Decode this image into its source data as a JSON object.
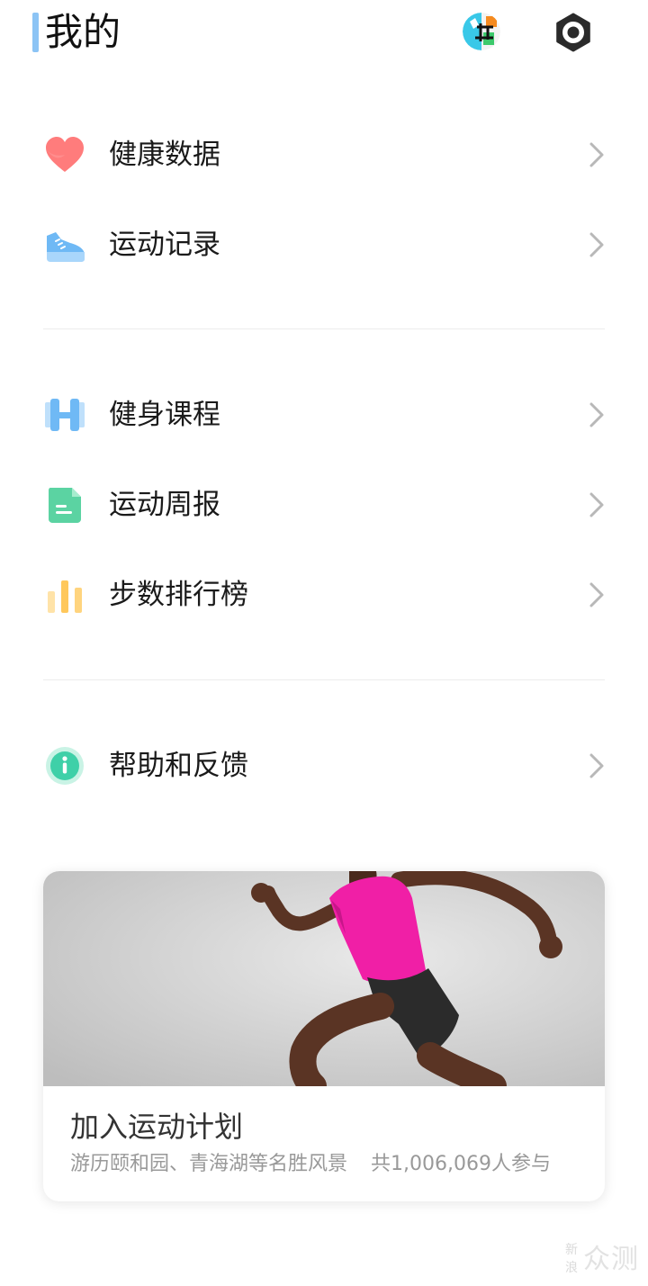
{
  "header": {
    "title": "我的"
  },
  "icons": {
    "avatar": "avatar-image",
    "settings": "settings-gear-icon",
    "heart": "heart-icon",
    "shoe": "running-shoe-icon",
    "course": "dumbbell-h-icon",
    "report": "document-icon",
    "ranking": "bar-chart-icon",
    "help": "info-icon",
    "chevron": "chevron-right-icon"
  },
  "colors": {
    "accent_bar": "#8cc4f5",
    "heart": "#ff7c7c",
    "shoe": "#6fb9f5",
    "course": "#6fb9f5",
    "report": "#5bd3a2",
    "ranking": "#ffc85c",
    "help": "#3fd0a8"
  },
  "menu": {
    "group1": [
      {
        "label": "健康数据"
      },
      {
        "label": "运动记录"
      }
    ],
    "group2": [
      {
        "label": "健身课程"
      },
      {
        "label": "运动周报"
      },
      {
        "label": "步数排行榜"
      }
    ],
    "group3": [
      {
        "label": "帮助和反馈"
      }
    ]
  },
  "promo": {
    "title": "加入运动计划",
    "description": "游历颐和园、青海湖等名胜风景",
    "participants": "共1,006,069人参与"
  },
  "watermark": {
    "small_top": "新",
    "small_bottom": "浪",
    "big": "众测"
  }
}
